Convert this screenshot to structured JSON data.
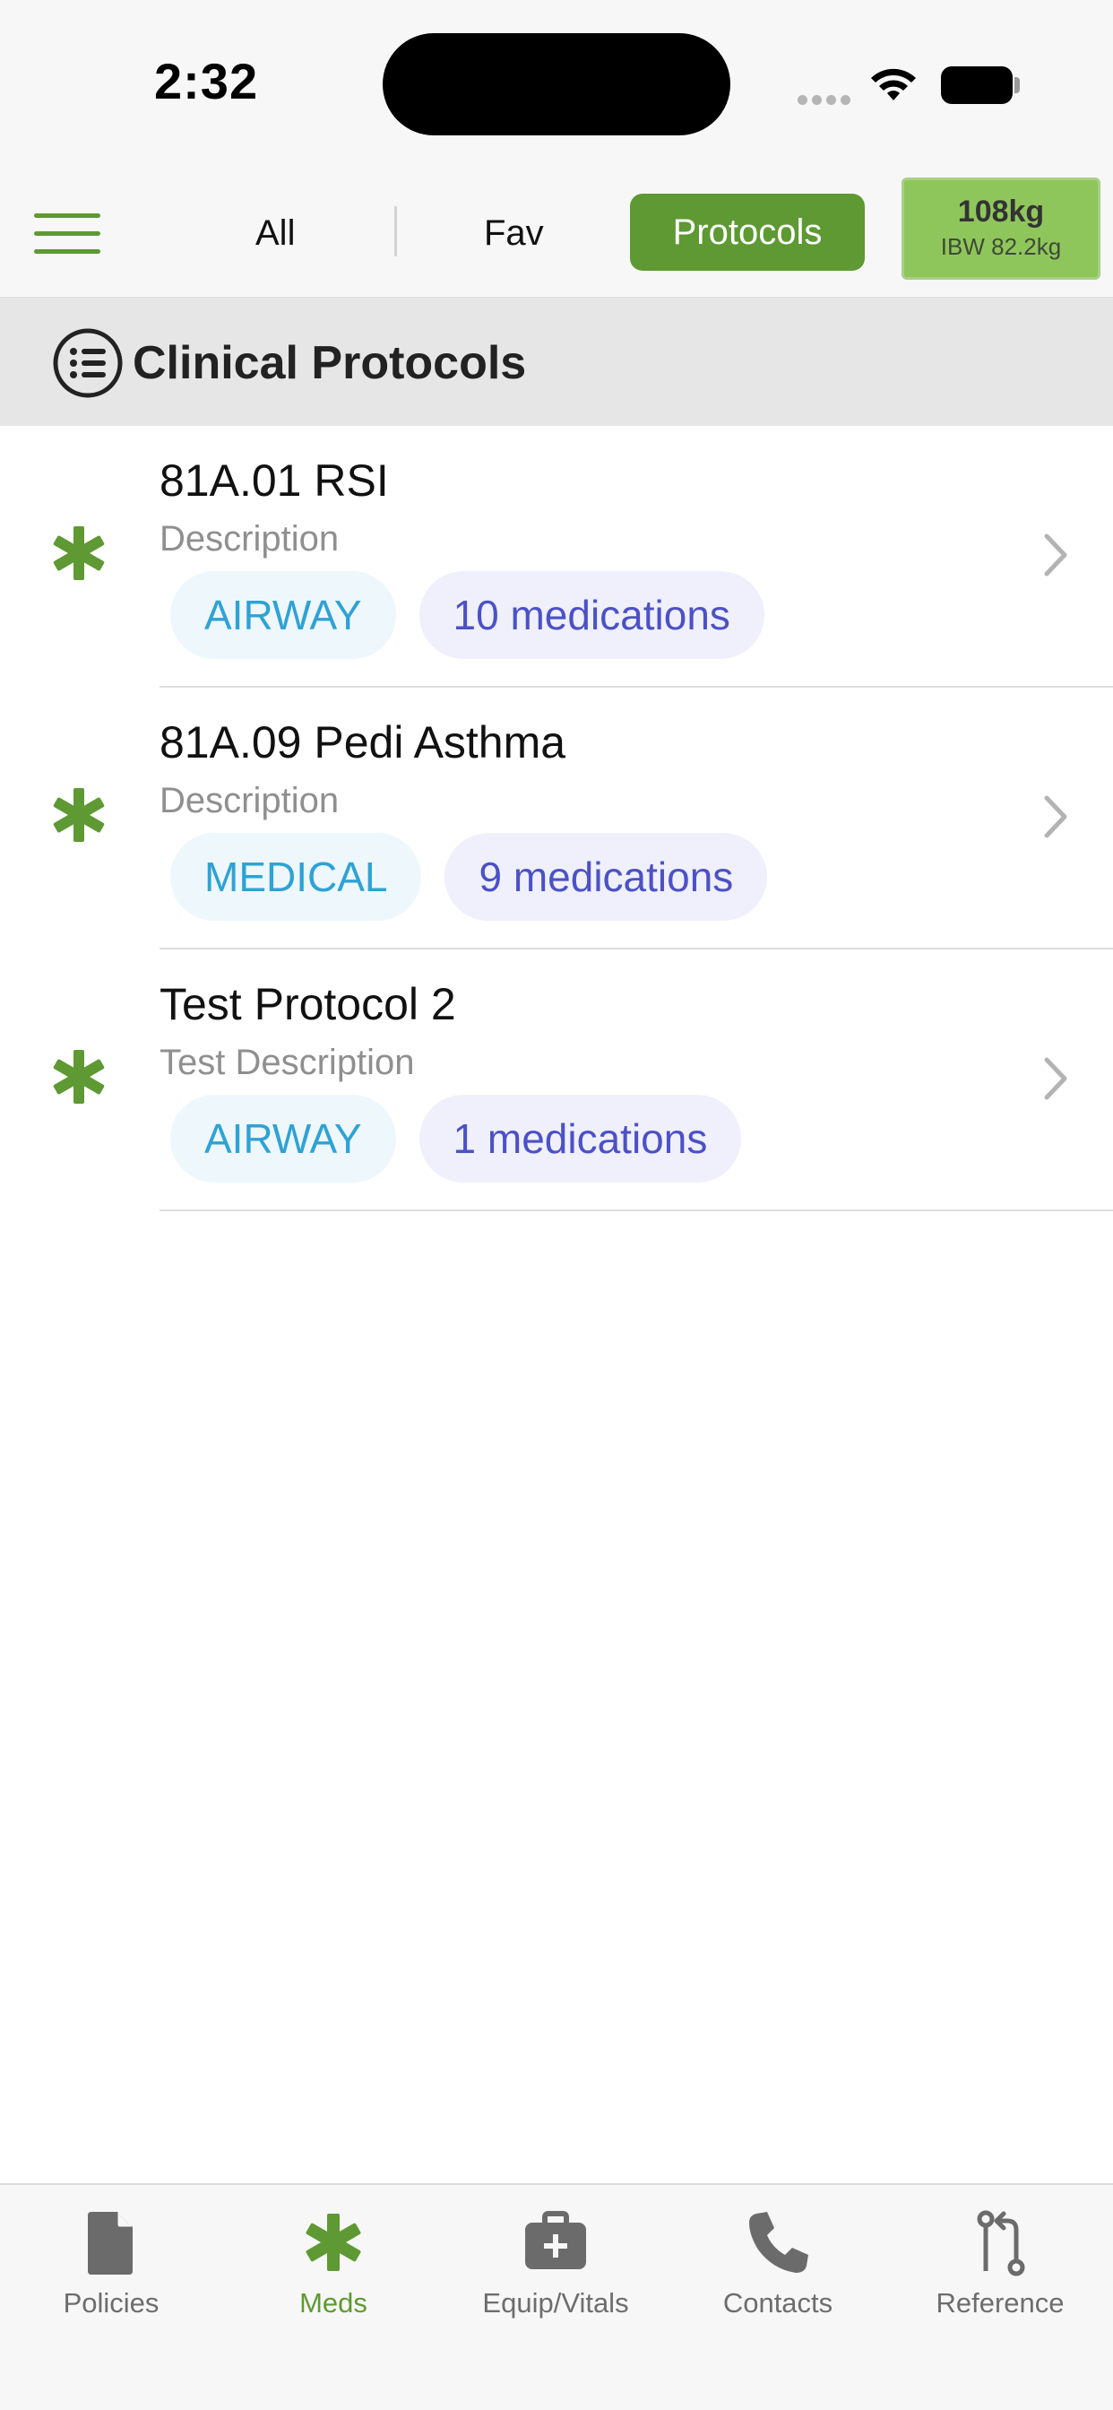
{
  "status_bar": {
    "time": "2:32"
  },
  "top_nav": {
    "segments": [
      "All",
      "Fav",
      "Protocols"
    ],
    "active_segment": "Protocols",
    "weight": "108kg",
    "ibw": "IBW 82.2kg"
  },
  "section": {
    "title": "Clinical Protocols",
    "icon": "list-circle-icon"
  },
  "protocols": [
    {
      "title": "81A.01 RSI",
      "description": "Description",
      "category": "AIRWAY",
      "medications": "10 medications"
    },
    {
      "title": "81A.09 Pedi Asthma",
      "description": "Description",
      "category": "MEDICAL",
      "medications": "9 medications"
    },
    {
      "title": "Test Protocol 2",
      "description": "Test Description",
      "category": "AIRWAY",
      "medications": "1 medications"
    }
  ],
  "tab_bar": {
    "active": "Meds",
    "tabs": [
      {
        "label": "Policies",
        "icon": "document-icon"
      },
      {
        "label": "Meds",
        "icon": "asterisk-icon"
      },
      {
        "label": "Equip/Vitals",
        "icon": "medkit-icon"
      },
      {
        "label": "Contacts",
        "icon": "phone-icon"
      },
      {
        "label": "Reference",
        "icon": "compare-arrows-icon"
      }
    ]
  },
  "colors": {
    "accent_green": "#5e9933",
    "weight_box": "#8fc65c",
    "category_text": "#2fa2d4",
    "medications_text": "#4c51c6"
  }
}
